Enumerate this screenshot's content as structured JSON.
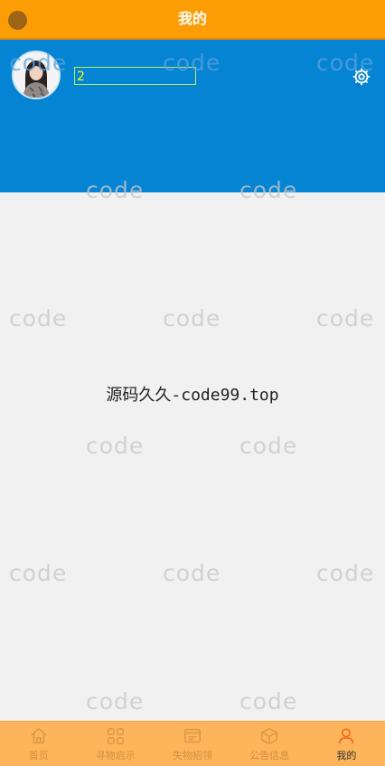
{
  "header": {
    "title": "我的"
  },
  "profile": {
    "username": "2"
  },
  "watermarks": [
    "code",
    "code",
    "code",
    "code",
    "code",
    "code",
    "code",
    "code",
    "code",
    "code",
    "code",
    "code",
    "code",
    "code",
    "code"
  ],
  "center_text": "源码久久-code99.top",
  "tabbar": {
    "items": [
      {
        "label": "首页",
        "icon": "home-icon"
      },
      {
        "label": "寻物启示",
        "icon": "grid-icon"
      },
      {
        "label": "失物招领",
        "icon": "board-icon"
      },
      {
        "label": "公告信息",
        "icon": "box-icon"
      },
      {
        "label": "我的",
        "icon": "user-icon"
      }
    ],
    "active_index": 4
  },
  "colors": {
    "header": "#fd9d06",
    "profile_bg": "#0684d4",
    "tabbar_bg": "#fdb45a",
    "active_icon": "#f36b22"
  }
}
